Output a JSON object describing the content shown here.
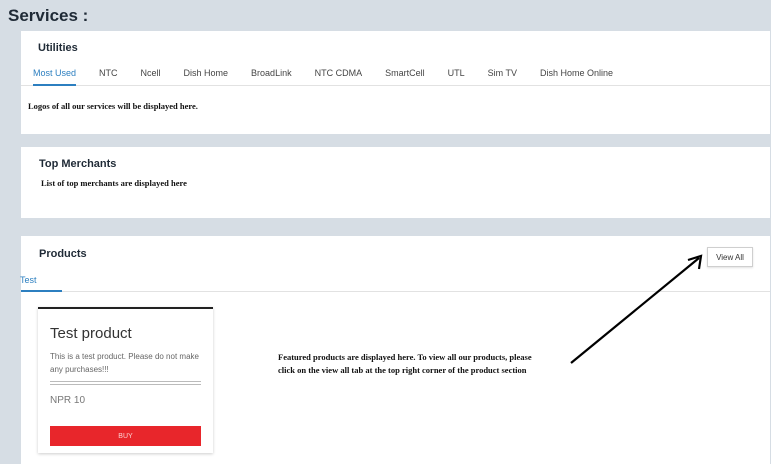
{
  "page": {
    "title": "Services :"
  },
  "utilities": {
    "title": "Utilities",
    "tabs": [
      "Most Used",
      "NTC",
      "Ncell",
      "Dish Home",
      "BroadLink",
      "NTC CDMA",
      "SmartCell",
      "UTL",
      "Sim TV",
      "Dish Home Online"
    ],
    "active_tab": "Most Used",
    "note": "Logos of all our services will be displayed here."
  },
  "merchants": {
    "title": "Top Merchants",
    "note": "List of top merchants are displayed here"
  },
  "products": {
    "title": "Products",
    "view_all_label": "View All",
    "tab_label": "Test",
    "note_line1": "Featured products are displayed here. To view all our products, please",
    "note_line2": "click on the view all tab at the top right corner of the product section",
    "product": {
      "name": "Test product",
      "description": "This is a test product. Please do not make any purchases!!!",
      "price": "NPR 10",
      "buy_label": "BUY"
    }
  },
  "colors": {
    "accent": "#2c7fc0",
    "buy_button": "#e8262b",
    "background": "#d6dde4"
  }
}
